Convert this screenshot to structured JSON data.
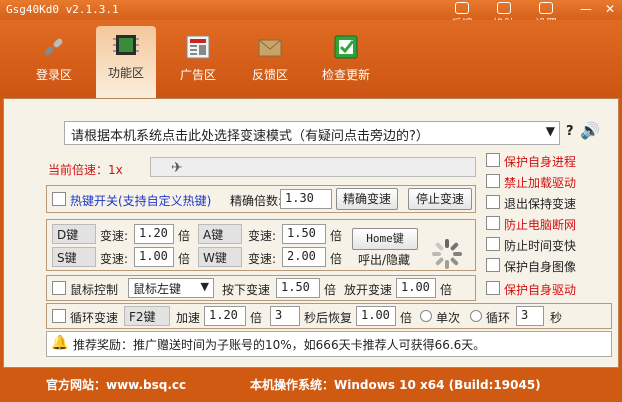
{
  "app": {
    "title": "Gsg40Kd0 v2.1.3.1",
    "top_links": [
      "反馈",
      "换肤",
      "设置"
    ]
  },
  "nav": {
    "items": [
      {
        "label": "登录区",
        "icon": "chain-link-icon"
      },
      {
        "label": "功能区",
        "icon": "chip-icon"
      },
      {
        "label": "广告区",
        "icon": "newspaper-icon"
      },
      {
        "label": "反馈区",
        "icon": "envelope-icon"
      },
      {
        "label": "检查更新",
        "icon": "check-update-icon"
      }
    ],
    "active_index": 1
  },
  "mode_select": {
    "value": "请根据本机系统点击此处选择变速模式（有疑问点击旁边的?）",
    "help": "?"
  },
  "speed": {
    "label": "当前倍速：1x",
    "slider_value": 1
  },
  "hotkey": {
    "label": "热键开关(支持自定义热键)",
    "precise_label": "精确倍数:",
    "precise_value": "1.30",
    "precise_btn": "精确变速",
    "stop_btn": "停止变速"
  },
  "keys": [
    {
      "key": "D键",
      "label": "变速:",
      "value": "1.20",
      "unit": "倍"
    },
    {
      "key": "A键",
      "label": "变速:",
      "value": "1.50",
      "unit": "倍"
    },
    {
      "key": "S键",
      "label": "变速:",
      "value": "1.00",
      "unit": "倍"
    },
    {
      "key": "W键",
      "label": "变速:",
      "value": "2.00",
      "unit": "倍"
    }
  ],
  "home": {
    "label": "Home键",
    "caption": "呼出/隐藏"
  },
  "mouse": {
    "label": "鼠标控制",
    "button": "鼠标左键",
    "down_label": "按下变速",
    "down_value": "1.50",
    "down_unit": "倍",
    "up_label": "放开变速",
    "up_value": "1.00",
    "up_unit": "倍"
  },
  "loop": {
    "label": "循环变速",
    "key": "F2键",
    "accel_label": "加速",
    "accel_value": "1.20",
    "accel_unit": "倍",
    "wait_value": "3",
    "after_label": "秒后恢复",
    "restore_value": "1.00",
    "restore_unit": "倍",
    "single_label": "单次",
    "loop_label": "循环",
    "loop_value": "3",
    "sec": "秒"
  },
  "right_options": [
    {
      "label": "保护自身进程",
      "color": "#d21010"
    },
    {
      "label": "禁止加载驱动",
      "color": "#d21010"
    },
    {
      "label": "退出保持变速",
      "color": "#222222"
    },
    {
      "label": "防止电脑断网",
      "color": "#d21010"
    },
    {
      "label": "防止时间变快",
      "color": "#222222"
    },
    {
      "label": "保护自身图像",
      "color": "#222222"
    },
    {
      "label": "保护自身驱动",
      "color": "#d21010"
    }
  ],
  "tip": "推荐奖励：推广赠送时间为子账号的10%，如666天卡推荐人可获得66.6天。",
  "footer": {
    "site": "官方网站：www.bsq.cc",
    "os": "本机操作系统：Windows 10 x64 (Build:19045)"
  },
  "colors": {
    "accent": "#d15a12",
    "red_text": "#d21010",
    "blue_text": "#1b39c7"
  }
}
